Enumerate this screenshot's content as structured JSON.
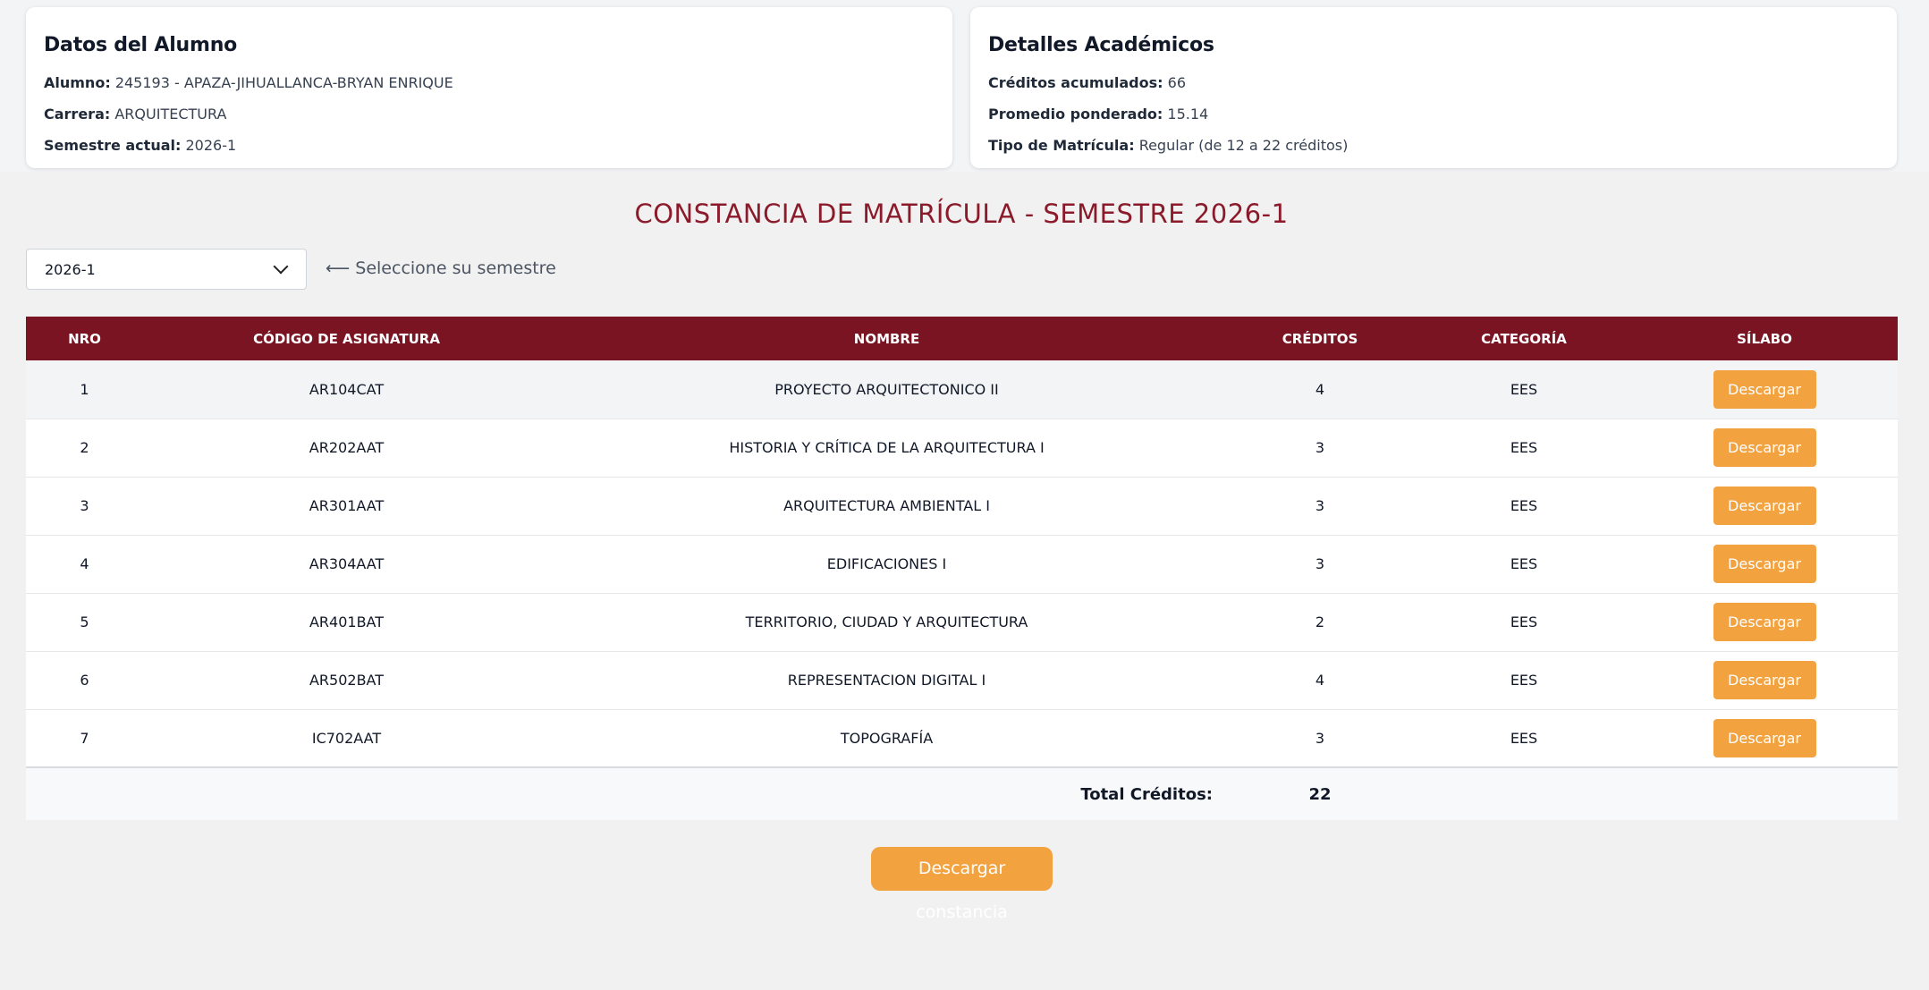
{
  "student_card": {
    "title": "Datos del Alumno",
    "alumno_label": "Alumno:",
    "alumno_value": "245193 - APAZA-JIHUALLANCA-BRYAN ENRIQUE",
    "carrera_label": "Carrera:",
    "carrera_value": "ARQUITECTURA",
    "semestre_label": "Semestre actual:",
    "semestre_value": "2026-1"
  },
  "academic_card": {
    "title": "Detalles Académicos",
    "creditos_label": "Créditos acumulados:",
    "creditos_value": "66",
    "promedio_label": "Promedio ponderado:",
    "promedio_value": "15.14",
    "tipo_label": "Tipo de Matrícula:",
    "tipo_value": "Regular (de 12 a 22 créditos)"
  },
  "heading": "CONSTANCIA DE MATRÍCULA - SEMESTRE 2026-1",
  "semester_select": {
    "selected": "2026-1",
    "hint": "⟵ Seleccione su semestre"
  },
  "table": {
    "headers": [
      "NRO",
      "CÓDIGO DE ASIGNATURA",
      "NOMBRE",
      "CRÉDITOS",
      "CATEGORÍA",
      "SÍLABO"
    ],
    "rows": [
      {
        "nro": "1",
        "codigo": "AR104CAT",
        "nombre": "PROYECTO ARQUITECTONICO II",
        "creditos": "4",
        "categoria": "EES",
        "silabo": "Descargar"
      },
      {
        "nro": "2",
        "codigo": "AR202AAT",
        "nombre": "HISTORIA Y CRÍTICA DE LA ARQUITECTURA I",
        "creditos": "3",
        "categoria": "EES",
        "silabo": "Descargar"
      },
      {
        "nro": "3",
        "codigo": "AR301AAT",
        "nombre": "ARQUITECTURA AMBIENTAL I",
        "creditos": "3",
        "categoria": "EES",
        "silabo": "Descargar"
      },
      {
        "nro": "4",
        "codigo": "AR304AAT",
        "nombre": "EDIFICACIONES I",
        "creditos": "3",
        "categoria": "EES",
        "silabo": "Descargar"
      },
      {
        "nro": "5",
        "codigo": "AR401BAT",
        "nombre": "TERRITORIO, CIUDAD Y ARQUITECTURA",
        "creditos": "2",
        "categoria": "EES",
        "silabo": "Descargar"
      },
      {
        "nro": "6",
        "codigo": "AR502BAT",
        "nombre": "REPRESENTACION DIGITAL I",
        "creditos": "4",
        "categoria": "EES",
        "silabo": "Descargar"
      },
      {
        "nro": "7",
        "codigo": "IC702AAT",
        "nombre": "TOPOGRAFÍA",
        "creditos": "3",
        "categoria": "EES",
        "silabo": "Descargar"
      }
    ],
    "total_label": "Total Créditos:",
    "total_value": "22"
  },
  "download_button": "Descargar constancia",
  "colors": {
    "header_bg": "#7a1422",
    "heading_text": "#8b1a2b",
    "button_bg": "#f2a23f"
  }
}
